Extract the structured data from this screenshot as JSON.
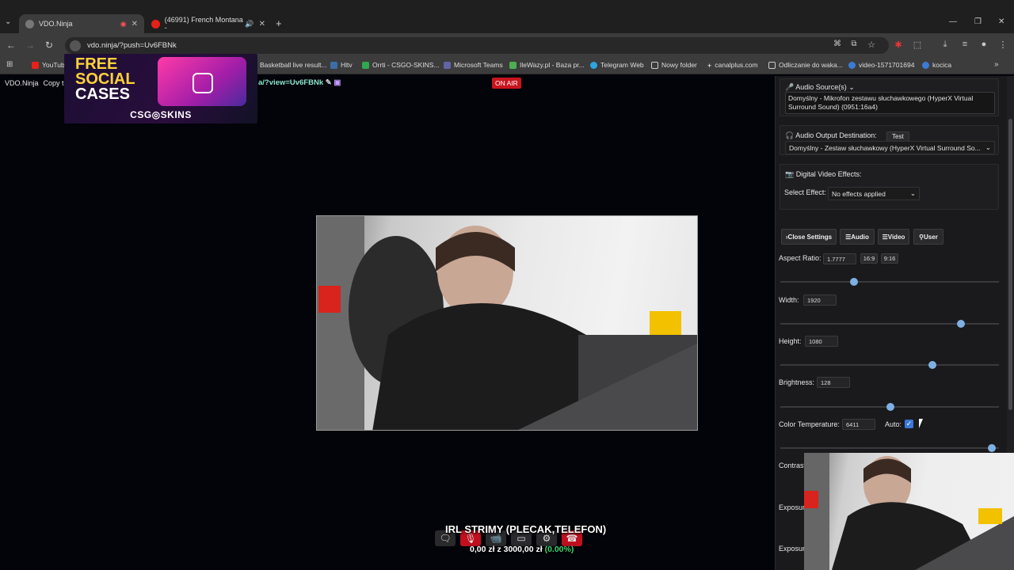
{
  "browser": {
    "tabs": [
      {
        "label": "VDO.Ninja",
        "active": true
      },
      {
        "label": "(46991) French Montana - ",
        "active": false
      }
    ],
    "url": "vdo.ninja/?push=Uv6FBNk",
    "bookmarks": [
      "YouTube",
      "Copy t",
      "Basketball live result...",
      "Hltv",
      "Orrti - CSGO-SKINS...",
      "Microsoft Teams",
      "IleWazy.pl - Baza pr...",
      "Telegram Web",
      "Nowy folder",
      "canalplus.com",
      "Odliczanie do waka...",
      "video-1571701694",
      "kocica"
    ]
  },
  "vdo": {
    "brand": "VDO.Ninja",
    "copy_label": "Copy t",
    "view_link": "a/?view=Uv6FBNk",
    "on_air": "ON AIR"
  },
  "ad": {
    "line1": "FREE",
    "line2": "SOCIAL",
    "line3": "CASES",
    "brand": "CSG◎SKINS"
  },
  "overlay": {
    "title": "IRL STRIMY (PLECAK,TELEFON)",
    "progress_text": "0,00 zł z 3000,00 zł",
    "progress_pct": "(0.00%)"
  },
  "settings": {
    "audio_source_label": "Audio Source(s)",
    "audio_source_value": "Domyślny - Mikrofon zestawu słuchawkowego (HyperX Virtual Surround Sound) (0951:16a4)",
    "audio_output_label": "Audio Output Destination:",
    "audio_output_test": "Test",
    "audio_output_value": "Domyślny - Zestaw słuchawkowy (HyperX Virtual Surround So...",
    "video_effects_label": "Digital Video Effects:",
    "select_effect_label": "Select Effect:",
    "select_effect_value": "No effects applied",
    "buttons": {
      "close": "Close Settings",
      "audio": "Audio",
      "video": "Video",
      "user": "User"
    },
    "aspect_label": "Aspect Ratio:",
    "aspect_value": "1.7777",
    "aspect_169": "16:9",
    "aspect_916": "9:16",
    "width_label": "Width:",
    "width_value": "1920",
    "height_label": "Height:",
    "height_value": "1080",
    "brightness_label": "Brightness:",
    "brightness_value": "128",
    "colortemp_label": "Color Temperature:",
    "colortemp_value": "6411",
    "auto_label": "Auto:",
    "contrast_label": "Contrast",
    "exposure1_label": "Exposure",
    "exposure2_label": "Exposure"
  }
}
